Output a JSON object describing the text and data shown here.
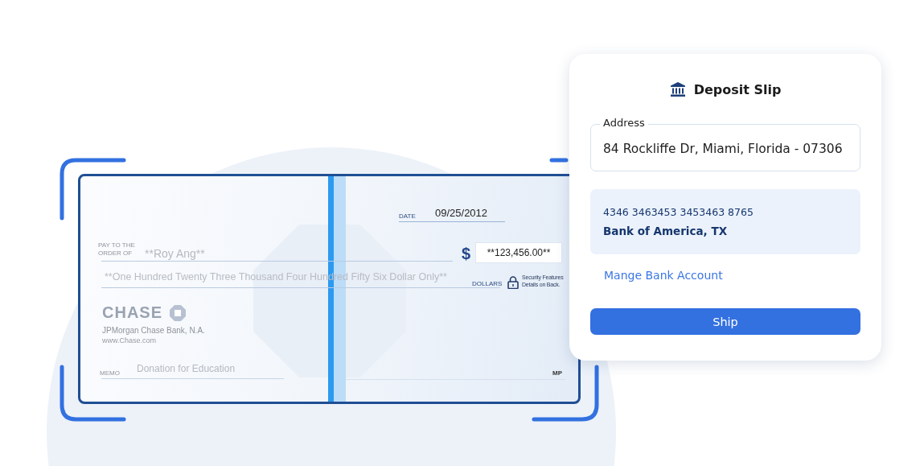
{
  "check": {
    "date_label": "DATE",
    "date": "09/25/2012",
    "payee_label": [
      "PAY TO THE",
      "ORDER OF"
    ],
    "payee": "**Roy Ang**",
    "currency_symbol": "$",
    "amount": "**123,456.00**",
    "amount_words": "**One Hundred Twenty Three Thousand Four Hundred Fifty Six Dollar Only**",
    "dollars_label": "DOLLARS",
    "security_note": [
      "Security Features",
      "Details on Back."
    ],
    "bank_logo": "CHASE",
    "bank_name": "JPMorgan Chase Bank, N.A.",
    "bank_website": "www.Chase.com",
    "memo_label": "MEMO",
    "memo": "Donation for Education",
    "signature": "MP"
  },
  "deposit_slip": {
    "title": "Deposit Slip",
    "address_field": {
      "label": "Address",
      "value": "84 Rockliffe Dr, Miami, Florida - 07306"
    },
    "account": {
      "number": "4346 3463453 3453463 8765",
      "bank": "Bank of America, TX"
    },
    "link": "Mange Bank Account",
    "button": "Ship"
  }
}
